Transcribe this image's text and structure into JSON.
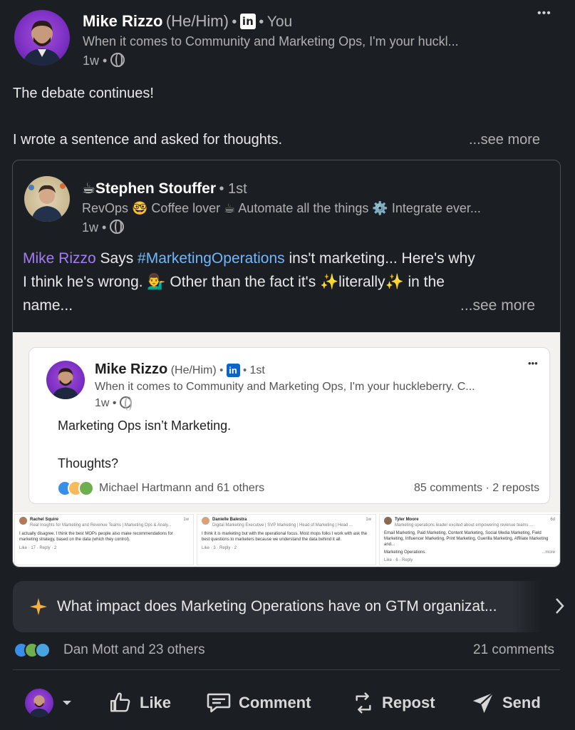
{
  "post": {
    "author": {
      "name": "Mike Rizzo",
      "pronouns": "(He/Him)",
      "badge": "in",
      "relation": "You",
      "headline": "When it comes to Community and Marketing Ops, I'm your huckl...",
      "age": "1w"
    },
    "menu_label": "•••",
    "text_line1": "The debate continues!",
    "text_line2": "I wrote a sentence and asked for thoughts.",
    "see_more": "...see more"
  },
  "shared": {
    "author": {
      "name": "☕Stephen Stouffer",
      "degree": "1st",
      "headline": "RevOps 🤓 Coffee lover ☕ Automate all the things ⚙️ Integrate ever...",
      "age": "1w"
    },
    "mention": "Mike Rizzo",
    "says": " Says ",
    "hashtag": "#MarketingOperations",
    "text_rest1": " ins't marketing... Here's why",
    "text_line2": "I think he's wrong. 💁‍♂️ Other than the fact it's ✨literally✨ in the",
    "text_line3": "name...",
    "see_more": "...see more"
  },
  "embedded": {
    "name": "Mike Rizzo",
    "pronouns": "(He/Him)",
    "badge": "in",
    "degree": "1st",
    "headline": "When it comes to Community and Marketing Ops, I'm your huckleberry. C...",
    "age": "1w",
    "menu_label": "•••",
    "text1": "Marketing Ops isn’t Marketing.",
    "text2": "Thoughts?",
    "reactors": "Michael Hartmann and 61 others",
    "stats": "85 comments · 2 reposts"
  },
  "comments": [
    {
      "name": "Rachel Squire",
      "headline": "Real Insights for Marketing and Revenue Teams | Marketing Ops & Analy...",
      "age": "1w",
      "text": "I actually disagree. I think the best MOPs people also make recommendations for marketing strategy, based on the data (which they control).",
      "likes": "Like · 17 · Reply · 2"
    },
    {
      "name": "Danielle Balestra",
      "headline": "Digital Marketing Executive | SVP Marketing | Head of Marketing | Head ...",
      "age": "1w",
      "text": "I think it is marketing but with the operational focus. Most mops folks I work with ask the best questions to marketers because we understand the data behind it all.",
      "likes": "Like · 3 · Reply · 2"
    },
    {
      "name": "Tyler Moore",
      "headline": "Marketing operations leader excited about empowering revenue teams ...",
      "age": "6d",
      "text": "Email Marketing, Paid Marketing, Content Marketing, Social Media Marketing, Field Marketing, Influencer Marketing, Print Marketing, Guerilla Marketing, Affiliate Marketing and...",
      "text2": "Marketing Operations.",
      "more": "...more",
      "likes": "Like · 6 · Reply"
    }
  ],
  "ai_prompt": {
    "text": "What impact does Marketing Operations have on GTM organizat...",
    "icon": "sparkle-icon"
  },
  "social": {
    "reactors": "Dan Mott and 23 others",
    "comments": "21 comments"
  },
  "actions": {
    "like": "Like",
    "comment": "Comment",
    "repost": "Repost",
    "send": "Send"
  },
  "colors": {
    "background": "#1b1f23",
    "mention": "#a47cf3",
    "hashtag": "#71b7fb",
    "text": "#e9e9e9",
    "muted": "#b0b0b0"
  }
}
